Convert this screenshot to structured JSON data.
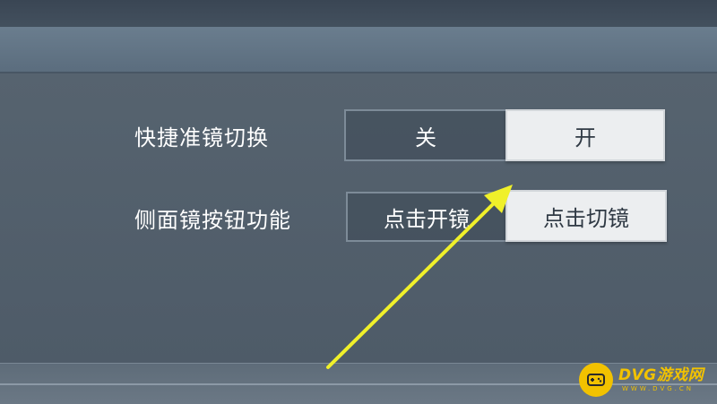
{
  "settings": [
    {
      "label": "快捷准镜切换",
      "options": [
        "关",
        "开"
      ],
      "selected": "开"
    },
    {
      "label": "侧面镜按钮功能",
      "options": [
        "点击开镜",
        "点击切镜"
      ],
      "selected": "点击切镜"
    }
  ],
  "annotation": {
    "arrow_color": "#f0f02a"
  },
  "watermark": {
    "main": "DVG游戏网",
    "sub": "WWW.DVG.CN",
    "color": "#f2c200"
  }
}
